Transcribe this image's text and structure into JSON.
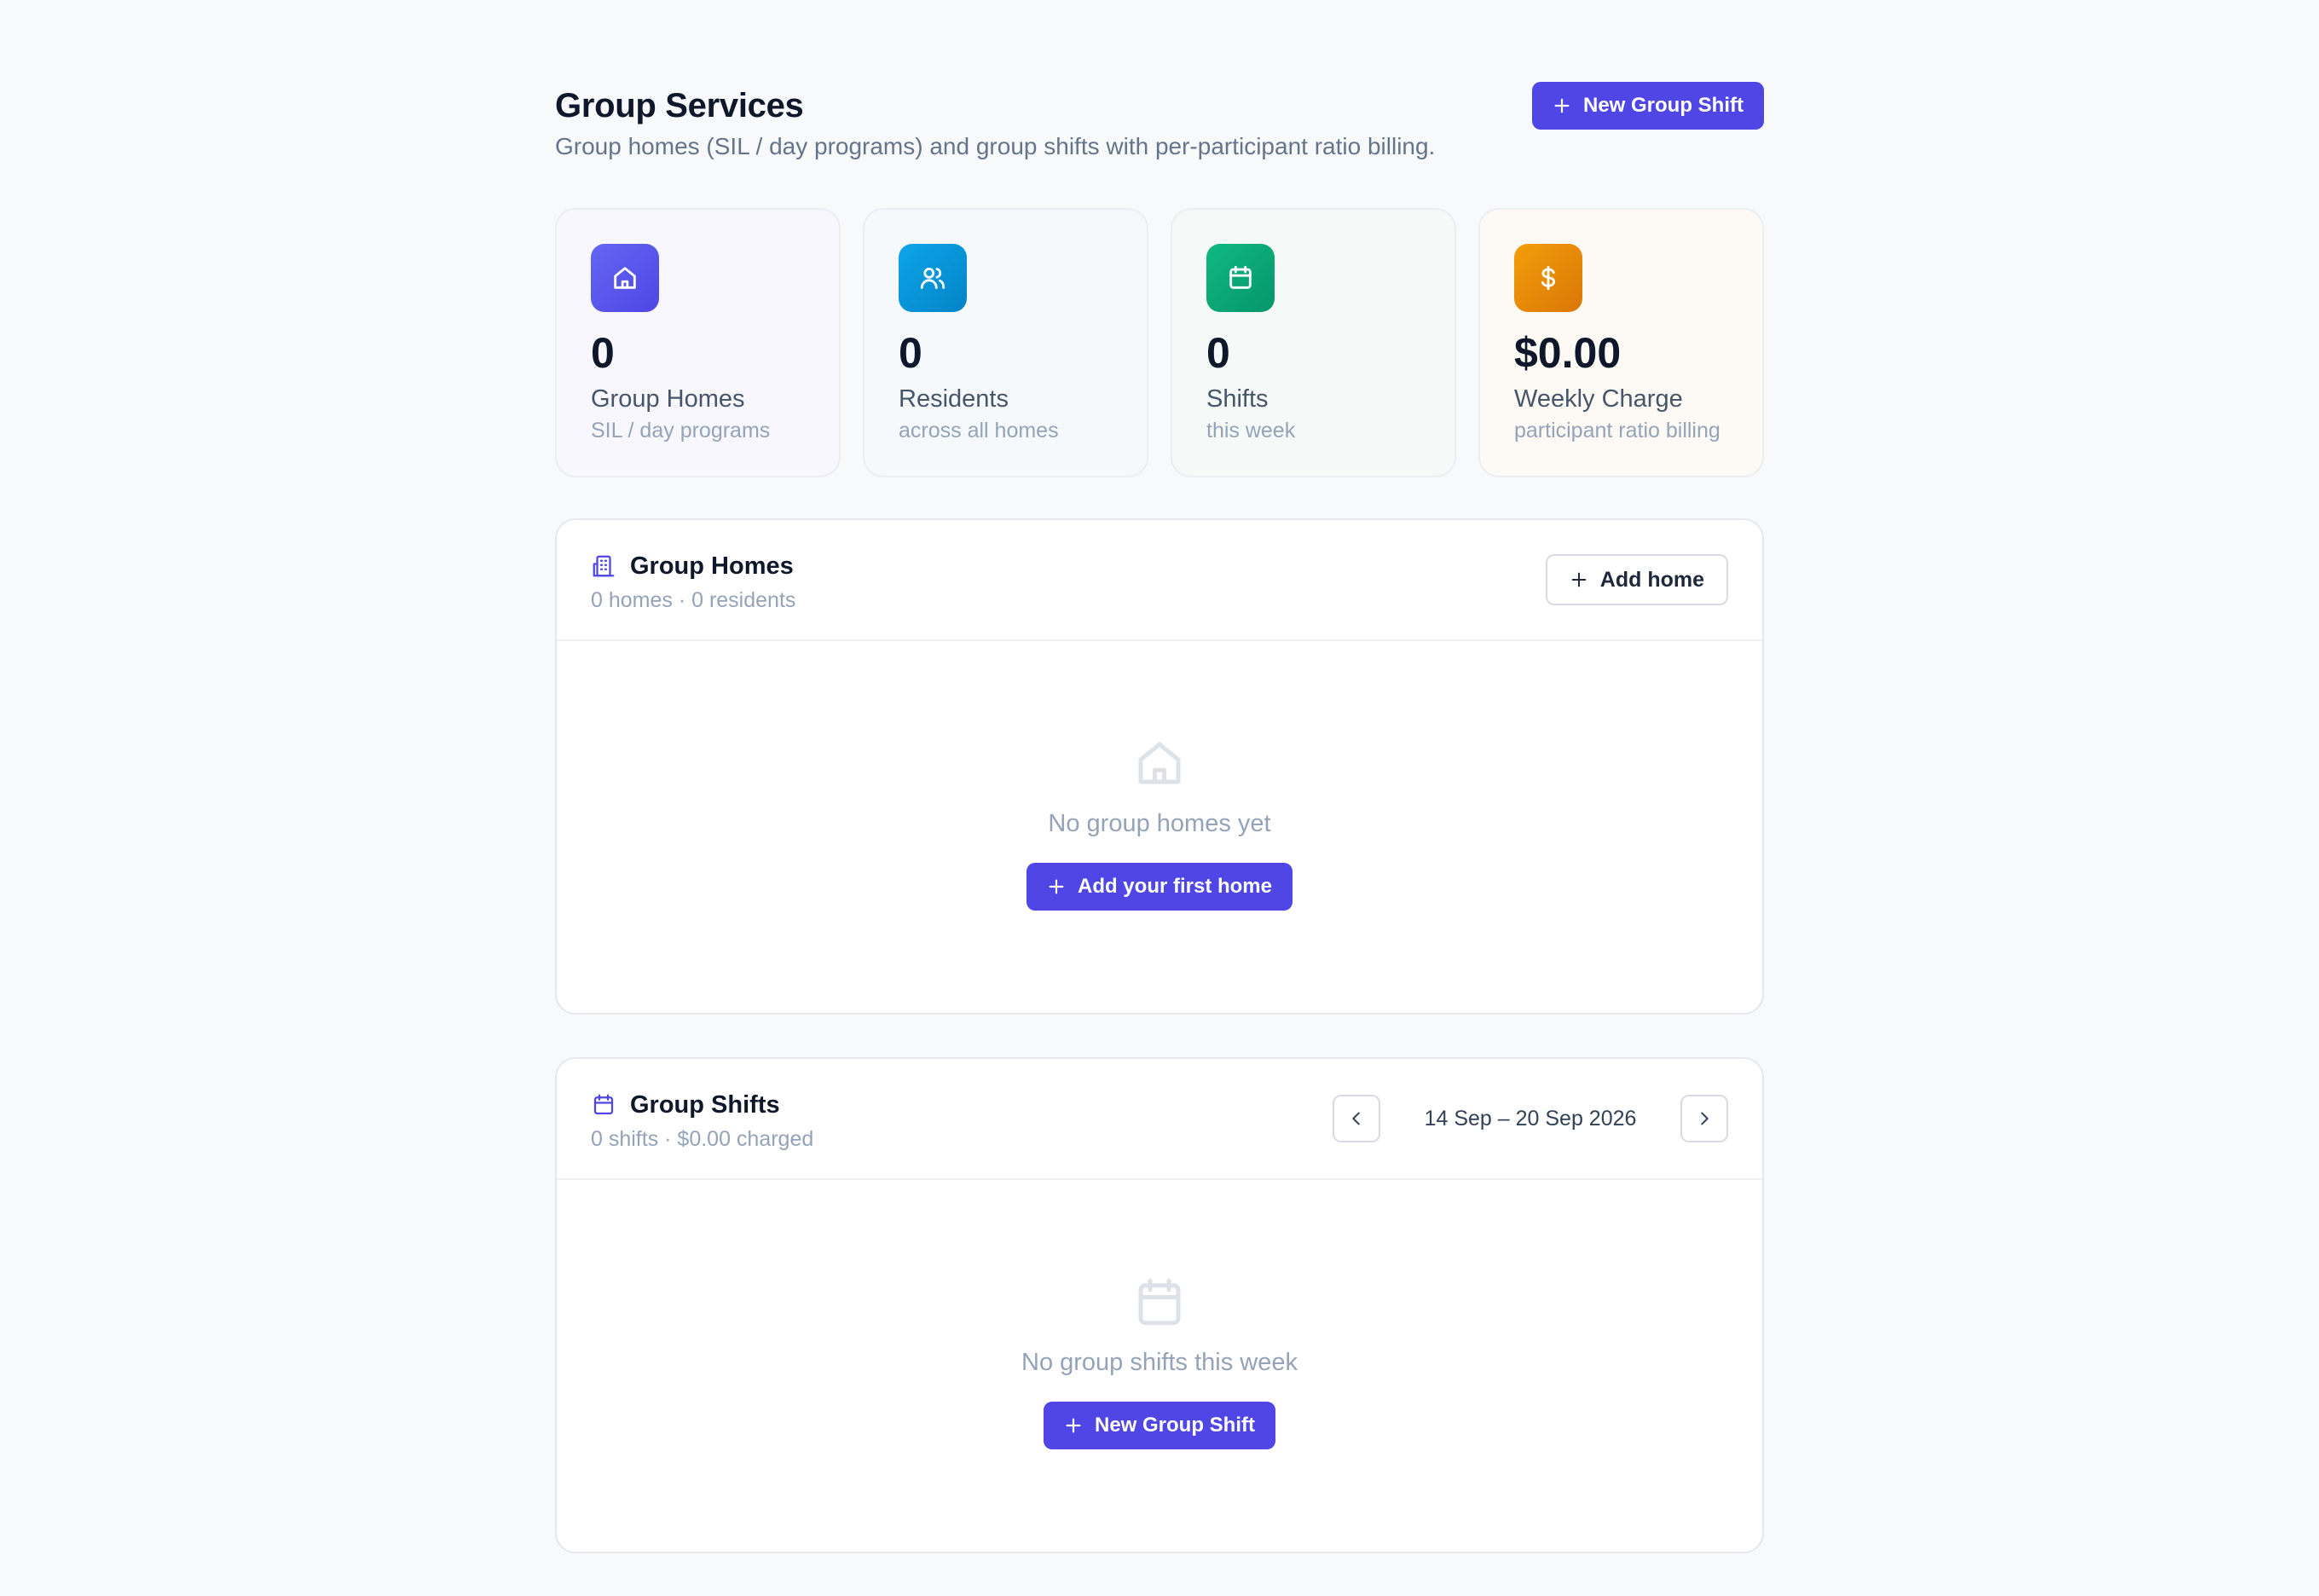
{
  "header": {
    "title": "Group Services",
    "subtitle": "Group homes (SIL / day programs) and group shifts with per-participant ratio billing.",
    "new_shift_label": "New Group Shift"
  },
  "stats": [
    {
      "icon": "home-icon",
      "value": "0",
      "label": "Group Homes",
      "sub": "SIL / day programs",
      "color": "#4f46e5"
    },
    {
      "icon": "users-icon",
      "value": "0",
      "label": "Residents",
      "sub": "across all homes",
      "color": "#0284c7"
    },
    {
      "icon": "calendar-icon",
      "value": "0",
      "label": "Shifts",
      "sub": "this week",
      "color": "#059669"
    },
    {
      "icon": "dollar-icon",
      "value": "$0.00",
      "label": "Weekly Charge",
      "sub": "participant ratio billing",
      "color": "#d97706"
    }
  ],
  "homes_panel": {
    "title": "Group Homes",
    "sub": "0 homes · 0 residents",
    "add_label": "Add home",
    "empty_text": "No group homes yet",
    "empty_button": "Add your first home"
  },
  "shifts_panel": {
    "title": "Group Shifts",
    "sub": "0 shifts · $0.00 charged",
    "week_range": "14 Sep – 20 Sep 2026",
    "empty_text": "No group shifts this week",
    "empty_button": "New Group Shift"
  },
  "colors": {
    "accent": "#4f46e5",
    "background": "#f8f9fb"
  }
}
